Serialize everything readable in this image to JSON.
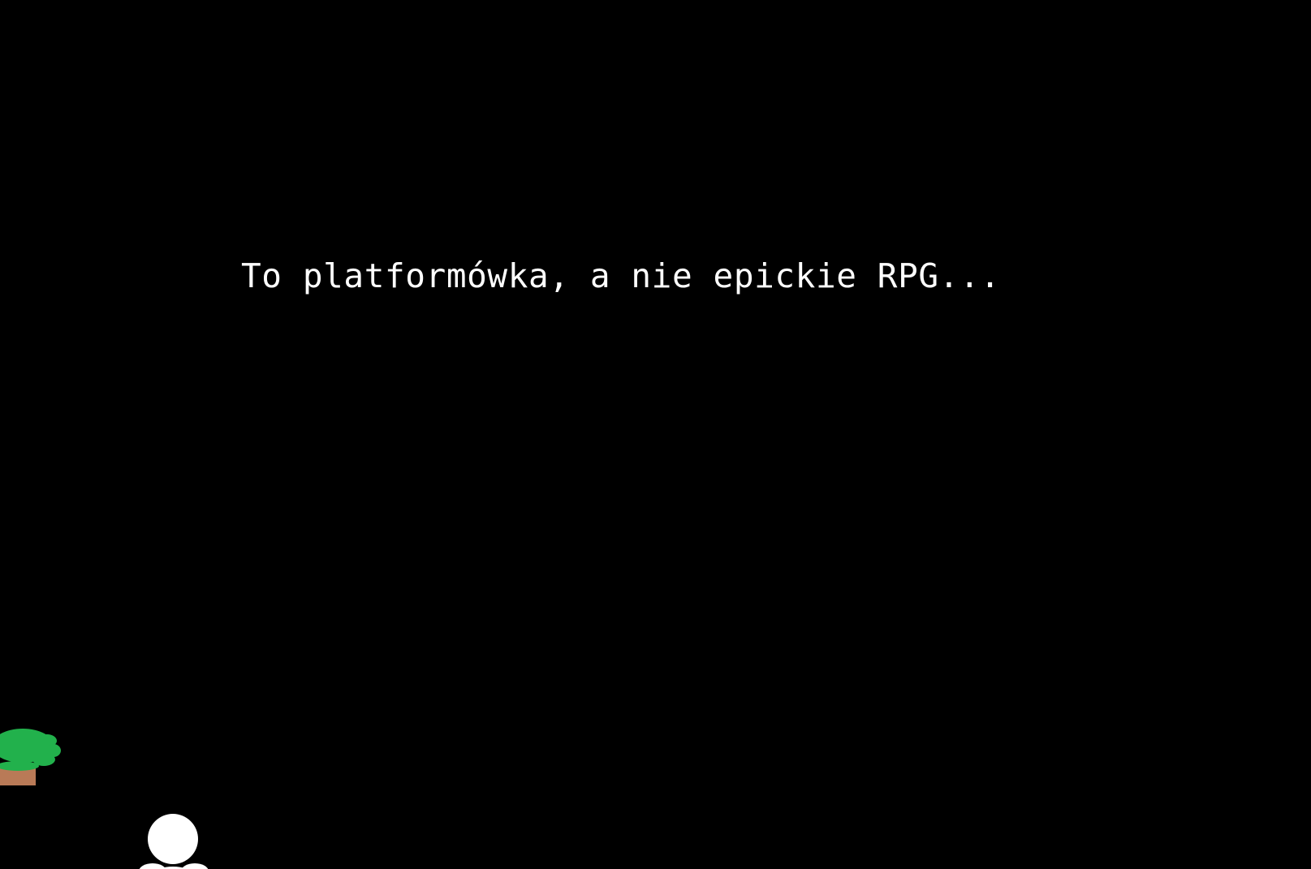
{
  "screen": {
    "background_color": "#000000"
  },
  "dialogue": {
    "text": "To platformówka, a nie epickie RPG...",
    "text_color": "#ffffff"
  },
  "sprites": {
    "tree_platform": {
      "icon": "tree-platform-icon",
      "foliage_color": "#22b14c",
      "trunk_color": "#b97a57"
    },
    "player": {
      "icon": "player-character-icon",
      "color": "#ffffff"
    }
  }
}
